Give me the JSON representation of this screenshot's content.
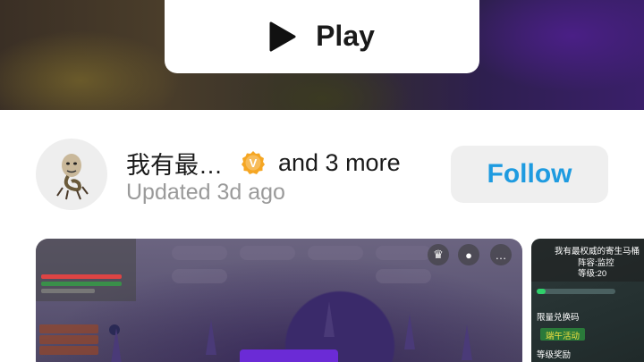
{
  "hero": {
    "play_label": "Play",
    "play_icon": "play-icon"
  },
  "creator": {
    "name": "我有最…",
    "verified_icon": "verified-badge-icon",
    "verified_color": "#f5a623",
    "more": "and 3 more",
    "updated": "Updated 3d ago",
    "follow_label": "Follow",
    "follow_color": "#1e9be0"
  },
  "screenshot_2": {
    "line1": "我有最权威的寄生马桶",
    "line2": "阵容:监控",
    "line3": "等级:20",
    "row1": "限量兑换码",
    "row2": "端午活动",
    "row3": "等级奖励"
  }
}
